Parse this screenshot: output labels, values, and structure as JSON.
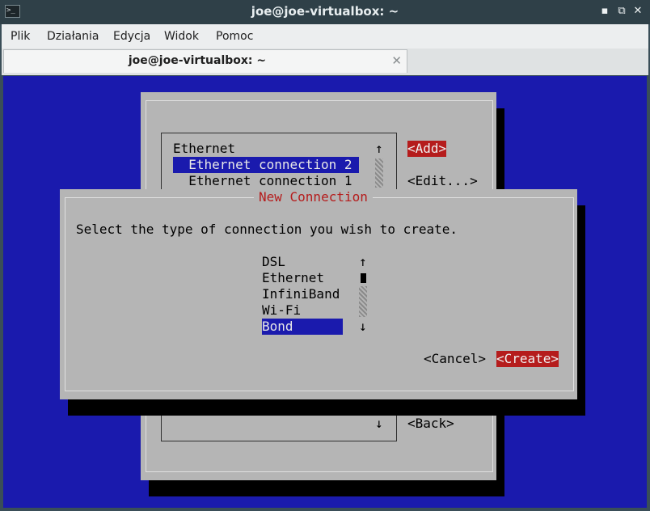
{
  "window": {
    "title": "joe@joe-virtualbox: ~",
    "app_icon_glyph": ">_",
    "minimize_glyph": "▪",
    "restore_glyph": "⧉",
    "close_glyph": "✕"
  },
  "menubar": {
    "items": [
      "Plik",
      "Działania",
      "Edycja",
      "Widok",
      "Pomoc"
    ]
  },
  "tabs": [
    {
      "label": "joe@joe-virtualbox: ~",
      "close_glyph": "✕"
    }
  ],
  "terminal": {
    "background": "#1a1aad",
    "main_list": {
      "items": [
        "Ethernet",
        "  Ethernet connection 2",
        "  Ethernet connection 1"
      ],
      "selected_index": 1,
      "scroll_up": "↑",
      "scroll_down": "↓"
    },
    "main_buttons": {
      "add": "<Add>",
      "edit": "<Edit...>",
      "back": "<Back>"
    },
    "dialog": {
      "title": "New Connection",
      "prompt": "Select the type of connection you wish to create.",
      "options": [
        "DSL",
        "Ethernet",
        "InfiniBand",
        "Wi-Fi",
        "Bond"
      ],
      "selected_option": "Bond",
      "scroll_up": "↑",
      "scroll_down": "↓",
      "cancel_label": "<Cancel>",
      "create_label": "<Create>"
    },
    "colors": {
      "selection": "#1a1aad",
      "accent_red": "#b51c1c",
      "panel": "#b5b5b5"
    }
  }
}
